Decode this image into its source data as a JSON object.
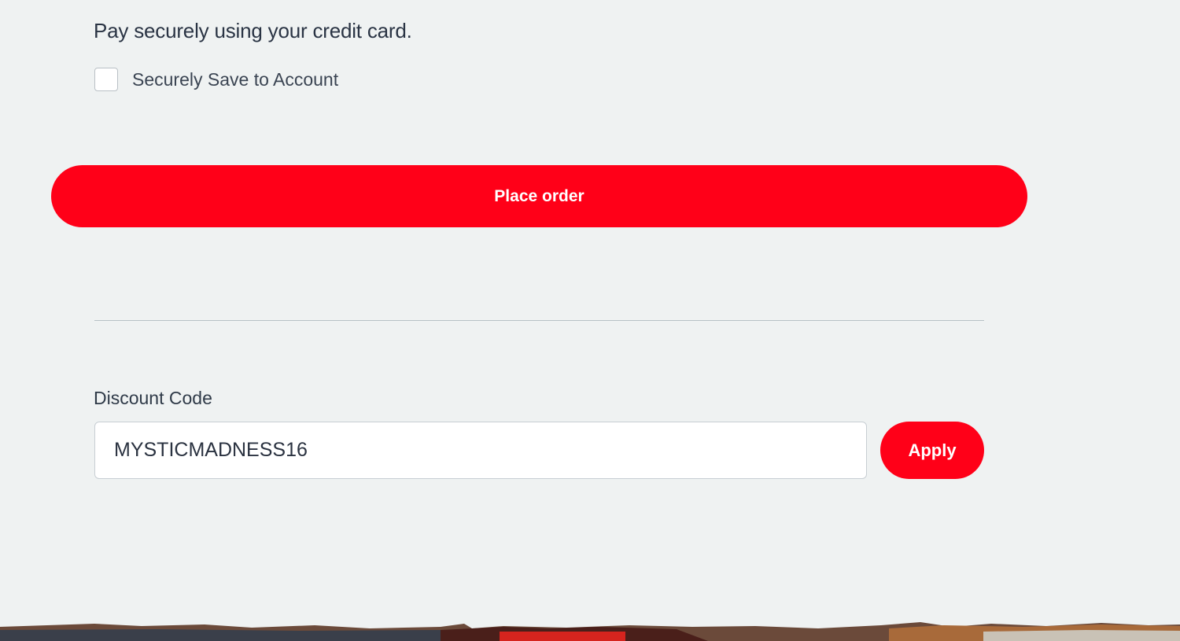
{
  "payment": {
    "note": "Pay securely using your credit card.",
    "save_label": "Securely Save to Account",
    "save_checked": false
  },
  "order": {
    "place_order_label": "Place order"
  },
  "discount": {
    "label": "Discount Code",
    "value": "MYSTICMADNESS16",
    "apply_label": "Apply"
  },
  "colors": {
    "accent": "#ff0018",
    "background": "#eff2f2"
  }
}
